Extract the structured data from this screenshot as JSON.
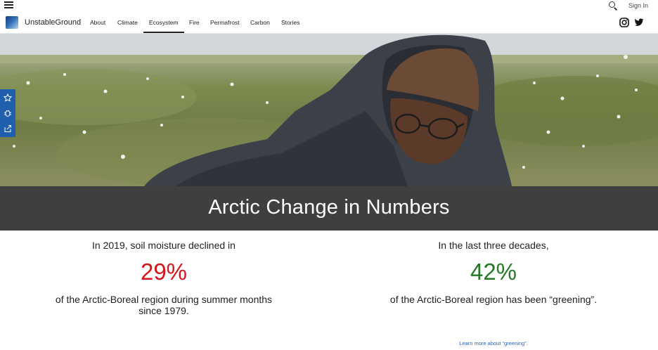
{
  "header": {
    "menu_icon": "hamburger-icon",
    "search_icon": "search-icon",
    "sign_in_label": "Sign In"
  },
  "nav": {
    "brand": "UnstableGround",
    "items": [
      {
        "label": "About"
      },
      {
        "label": "Climate"
      },
      {
        "label": "Ecosystem",
        "active": true
      },
      {
        "label": "Fire"
      },
      {
        "label": "Permafrost"
      },
      {
        "label": "Carbon"
      },
      {
        "label": "Stories"
      }
    ],
    "social_icons": [
      "instagram-icon",
      "twitter-icon"
    ]
  },
  "side_rail": {
    "icons": [
      "star-icon",
      "bug-icon",
      "share-icon"
    ],
    "color": "#1f5fae"
  },
  "hero": {
    "title": "Arctic Change in Numbers"
  },
  "stats": [
    {
      "lead": "In 2019, soil moisture declined in",
      "value": "29%",
      "tail": "of the Arctic-Boreal region during summer months since 1979.",
      "color": "#d4151b"
    },
    {
      "lead": "In the last three decades,",
      "value": "42%",
      "tail": "of the Arctic-Boreal region has been “greening”.",
      "color": "#267a27",
      "link": "Learn more about “greening”."
    }
  ]
}
